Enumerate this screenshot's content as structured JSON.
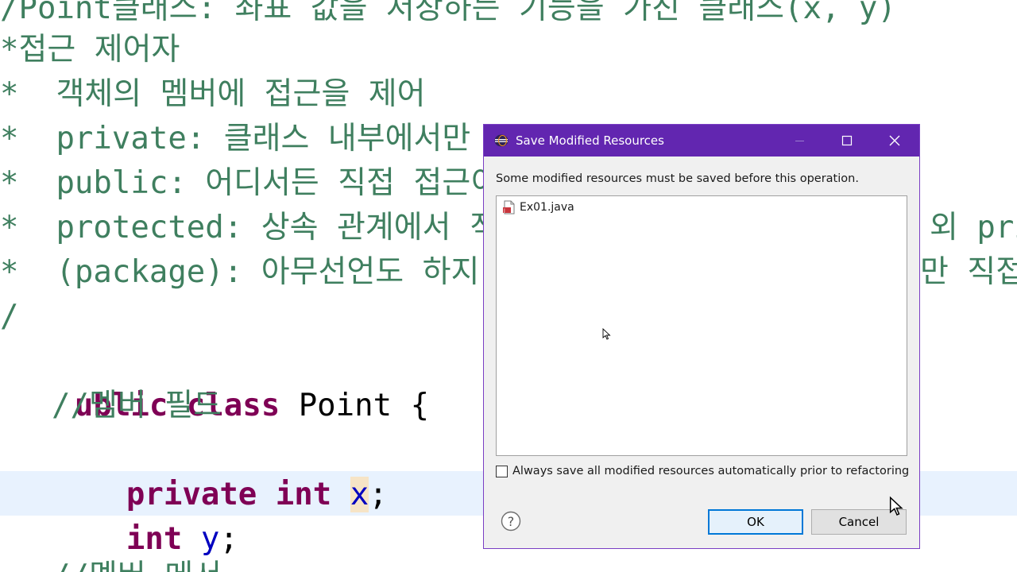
{
  "editor": {
    "lines": {
      "l1": "/Point클래스: 좌표 값을 저장하는 기능을 가진 클래스(x, y)",
      "l2": "*접근 제어자",
      "l3": "*  객체의 멤버에 접근을 제어",
      "l4a": "*  private: 클래스 내부에서만 ",
      "l5a": "*  public: 어디서든 직접 접근이",
      "l6a": "*  protected: 상속 관계에서 직",
      "l6b": "외 pri",
      "l7a": "*  (package): 아무선언도 하지",
      "l7b": "만 직접",
      "l8": "/",
      "l9_kw1": "ublic",
      "l9_kw2": "class",
      "l9_rest": "Point {",
      "l10": "//멤버 필드",
      "l11_kw1": "private",
      "l11_kw2": "int",
      "l11_field": "x",
      "l11_end": ";",
      "l12_kw": "int",
      "l12_field": "y",
      "l12_end": ";",
      "l13": "//멤버 메서"
    }
  },
  "dialog": {
    "title": "Save Modified Resources",
    "message": "Some modified resources must be saved before this operation.",
    "files": [
      "Ex01.java"
    ],
    "checkbox_label": "Always save all modified resources automatically prior to refactoring",
    "checkbox_checked": false,
    "ok_label": "OK",
    "cancel_label": "Cancel",
    "title_bar_color": "#6226b0",
    "help_icon": "question-circle-icon",
    "file_icon": "java-file-icon"
  }
}
